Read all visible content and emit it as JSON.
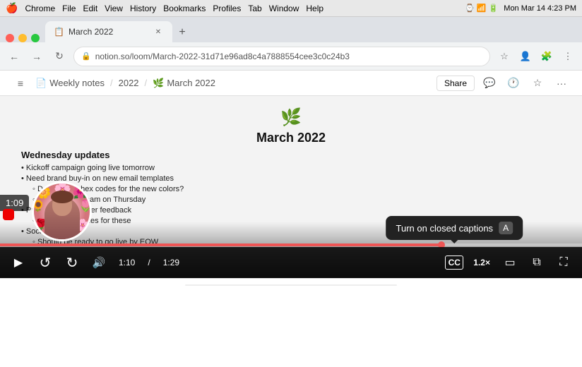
{
  "menubar": {
    "apple": "🍎",
    "app": "Chrome",
    "menus": [
      "File",
      "Edit",
      "View",
      "History",
      "Bookmarks",
      "Profiles",
      "Tab",
      "Window",
      "Help"
    ],
    "time": "Mon Mar 14  4:23 PM",
    "icons": [
      "wifi",
      "battery",
      "clock"
    ]
  },
  "browser": {
    "tab_title": "March 2022",
    "url": "notion.so/loom/March-2022-31d71e96ad8c4a7888554cee3c0c24b3",
    "new_tab_label": "+",
    "back_icon": "←",
    "forward_icon": "→",
    "refresh_icon": "↻"
  },
  "notion_nav": {
    "sidebar_icon": "≡",
    "weekly_notes": "Weekly notes",
    "year": "2022",
    "page": "March 2022",
    "share_label": "Share",
    "more_icon": "···"
  },
  "page": {
    "icon": "🌿",
    "title": "March 2022",
    "section_title": "Wednesday updates",
    "bullets": [
      {
        "text": "Kickoff campaign going live tomorrow",
        "sub": []
      },
      {
        "text": "Need brand buy-in on new email templates",
        "sub": [
          "Do we have hex codes for the new colors?",
          "Meeting with team on Thursday"
        ]
      },
      {
        "text": "Presentation on user feedback",
        "sub": [
          "Working on slides for these"
        ]
      },
      {
        "text": "Social calendar",
        "sub": [
          "Should be ready to go live by EOW"
        ]
      }
    ]
  },
  "video": {
    "timer": "1:09",
    "progress_current": "1:10",
    "progress_total": "1:29",
    "progress_percent": 75.8,
    "cc_tooltip": "Turn on closed captions",
    "cc_kbd": "A",
    "speed": "1.2×",
    "controls": {
      "play": "▶",
      "rewind": "↩",
      "forward": "↪",
      "volume": "🔊",
      "cc": "CC",
      "pip": "⧉",
      "theater": "▭",
      "fullscreen": "⛶"
    }
  }
}
